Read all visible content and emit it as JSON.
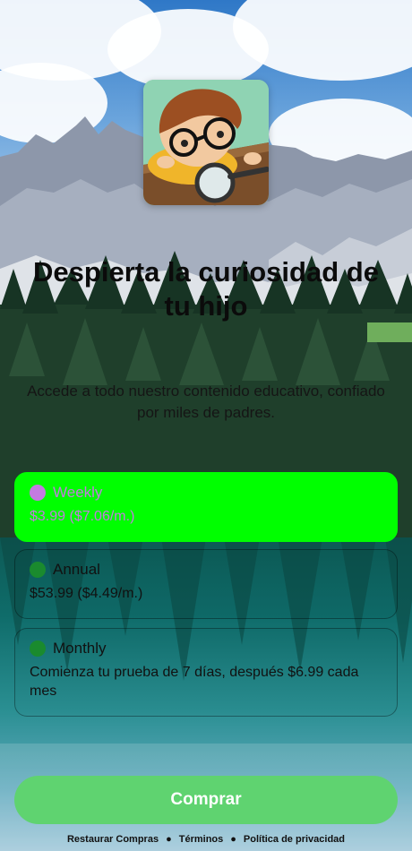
{
  "header": {
    "title": "Despierta la curiosidad de tu hijo",
    "subtitle": "Accede a todo nuestro contenido educativo, confiado por miles de padres."
  },
  "plans": [
    {
      "name": "Weekly",
      "price": "$3.99 ($7.06/m.)",
      "selected": true
    },
    {
      "name": "Annual",
      "price": "$53.99 ($4.49/m.)",
      "selected": false
    },
    {
      "name": "Monthly",
      "price": "Comienza tu prueba de 7 días, después $6.99 cada mes",
      "selected": false
    }
  ],
  "buy_button": {
    "label": "Comprar"
  },
  "footer": {
    "restore": "Restaurar Compras",
    "terms": "Términos",
    "privacy": "Política de privacidad",
    "separator": "●"
  },
  "colors": {
    "selected_plan_bg": "#00ff00",
    "selected_text": "#c37be0",
    "radio": "#1a8a2e",
    "buy_button": "#5fd370"
  },
  "icons": {
    "app_icon": "curious-child-magnifier-icon"
  }
}
